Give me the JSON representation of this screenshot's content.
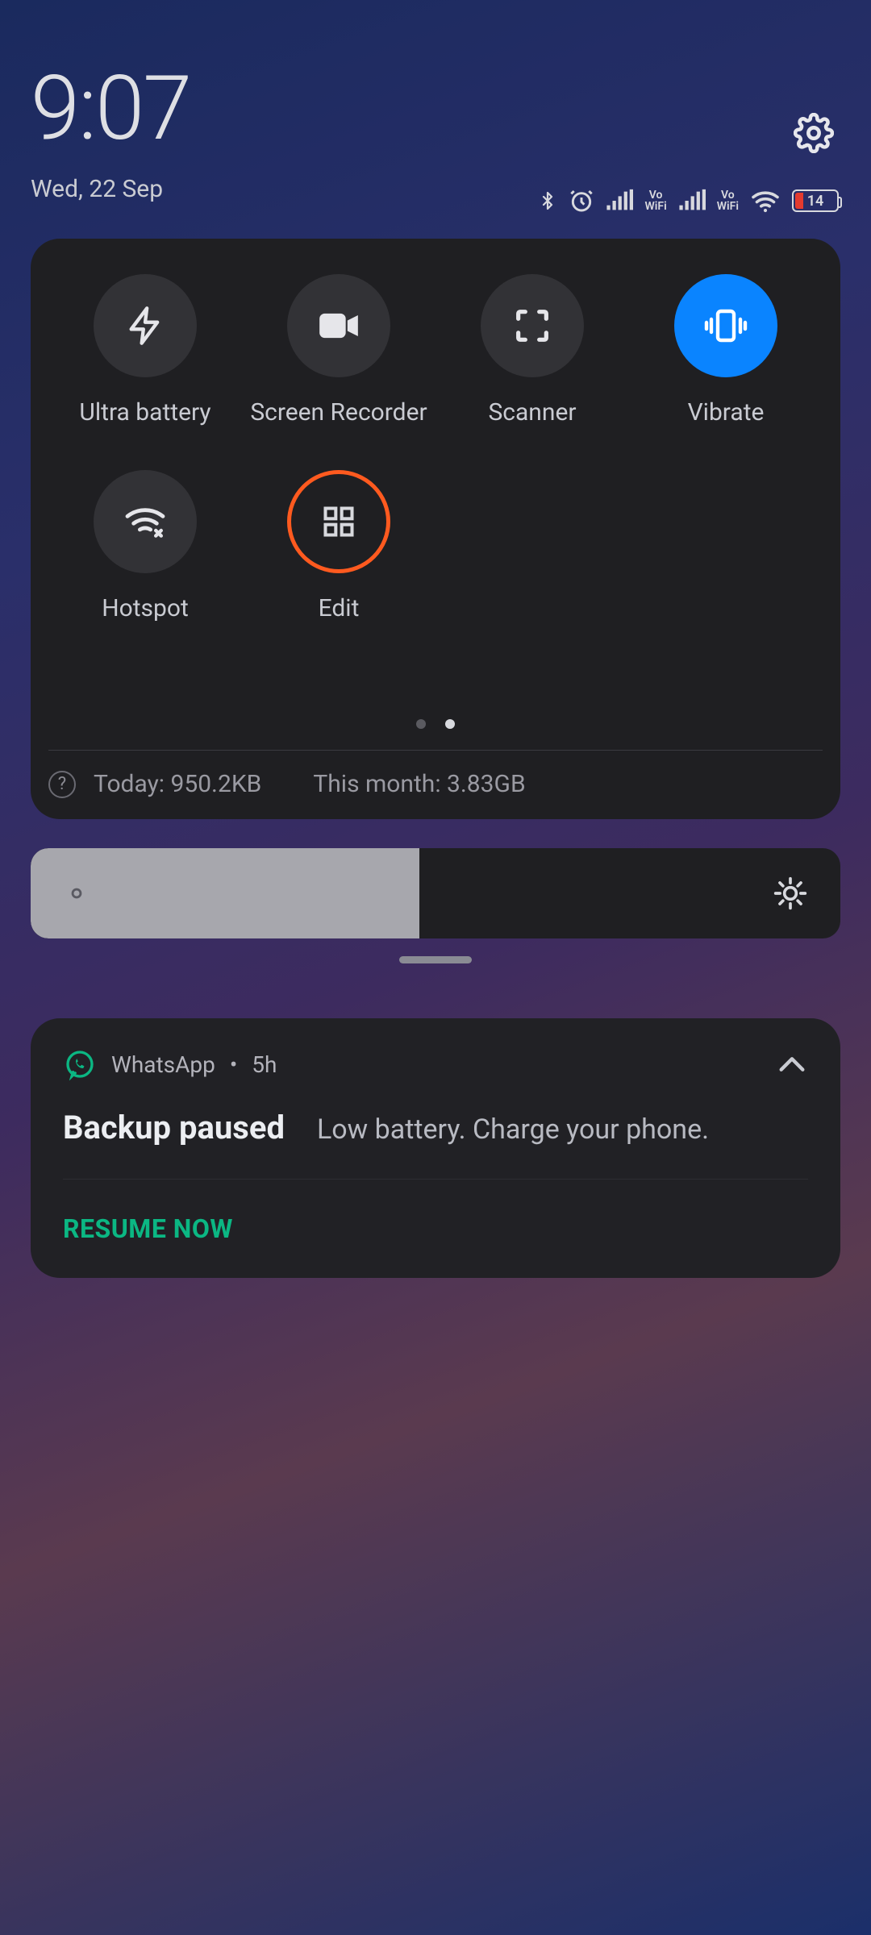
{
  "header": {
    "time": "9:07",
    "date": "Wed, 22 Sep",
    "battery_percent": "14"
  },
  "quick_settings": {
    "tiles": [
      {
        "label": "Ultra battery",
        "icon": "bolt-icon",
        "state": "off"
      },
      {
        "label": "Screen Recorder",
        "icon": "video-icon",
        "state": "off"
      },
      {
        "label": "Scanner",
        "icon": "scan-icon",
        "state": "off"
      },
      {
        "label": "Vibrate",
        "icon": "vibrate-icon",
        "state": "on"
      },
      {
        "label": "Hotspot",
        "icon": "hotspot-icon",
        "state": "off"
      },
      {
        "label": "Edit",
        "icon": "grid-icon",
        "state": "edit"
      }
    ],
    "pager": {
      "count": 2,
      "active_index": 1
    },
    "data_usage": {
      "today_label": "Today: 950.2KB",
      "month_label": "This month: 3.83GB"
    }
  },
  "brightness": {
    "percent": 48
  },
  "notification": {
    "app": "WhatsApp",
    "age": "5h",
    "title": "Backup paused",
    "text": "Low battery. Charge your phone.",
    "action": "RESUME NOW"
  }
}
